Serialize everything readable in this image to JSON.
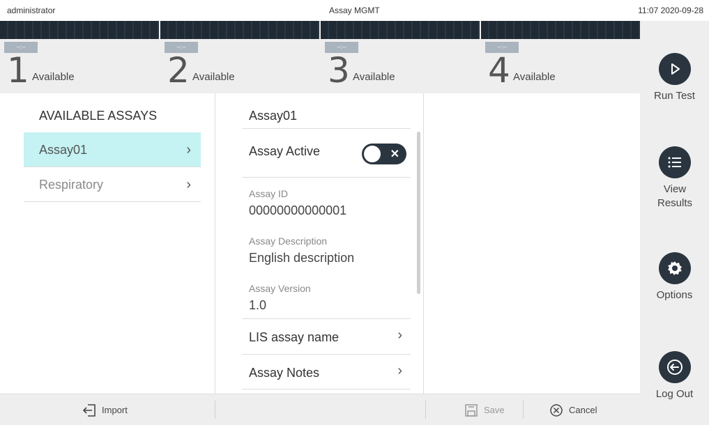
{
  "topbar": {
    "user": "administrator",
    "title": "Assay MGMT",
    "time": "11:07 2020-09-28"
  },
  "modules": [
    {
      "number": "1",
      "status": "Available",
      "mini": "--:--"
    },
    {
      "number": "2",
      "status": "Available",
      "mini": "--:--"
    },
    {
      "number": "3",
      "status": "Available",
      "mini": "--:--"
    },
    {
      "number": "4",
      "status": "Available",
      "mini": "--:--"
    }
  ],
  "sidebar": {
    "run_test": "Run Test",
    "view_results": "View Results",
    "options": "Options",
    "log_out": "Log Out"
  },
  "assays": {
    "header": "AVAILABLE ASSAYS",
    "items": [
      "Assay01",
      "Respiratory"
    ]
  },
  "detail": {
    "header": "Assay01",
    "active_label": "Assay Active",
    "assay_id_label": "Assay ID",
    "assay_id": "00000000000001",
    "description_label": "Assay Description",
    "description": "English description",
    "version_label": "Assay Version",
    "version": "1.0",
    "lis_name": "LIS assay name",
    "notes": "Assay Notes"
  },
  "bottombar": {
    "import": "Import",
    "save": "Save",
    "cancel": "Cancel"
  },
  "colors": {
    "dark": "#2a3540",
    "selected": "#c5f2f2",
    "panel": "#eeeeee"
  }
}
